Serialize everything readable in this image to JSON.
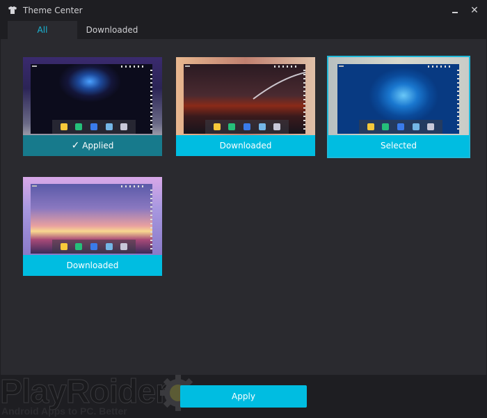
{
  "window": {
    "title": "Theme Center",
    "title_icon": "tshirt-icon",
    "minimize_icon": "minimize-icon",
    "close_icon": "close-icon",
    "close_glyph": "✕"
  },
  "tabs": [
    {
      "label": "All",
      "active": true
    },
    {
      "label": "Downloaded",
      "active": false
    }
  ],
  "themes": [
    {
      "name": "galaxy",
      "status": "Applied",
      "status_icon": "checkmark-icon",
      "check_glyph": "✓",
      "selected": false
    },
    {
      "name": "comet",
      "status": "Downloaded",
      "selected": false
    },
    {
      "name": "blue-feathers",
      "status": "Selected",
      "selected": true
    },
    {
      "name": "sunset",
      "status": "Downloaded",
      "selected": false
    }
  ],
  "footer": {
    "apply_label": "Apply"
  },
  "watermark": {
    "brand": "PlayRoider",
    "tagline": "Android Apps to PC. Better"
  },
  "colors": {
    "accent": "#00bde1",
    "applied": "#177a8c",
    "background": "#1e1e22",
    "panel": "#2a2a2f"
  }
}
